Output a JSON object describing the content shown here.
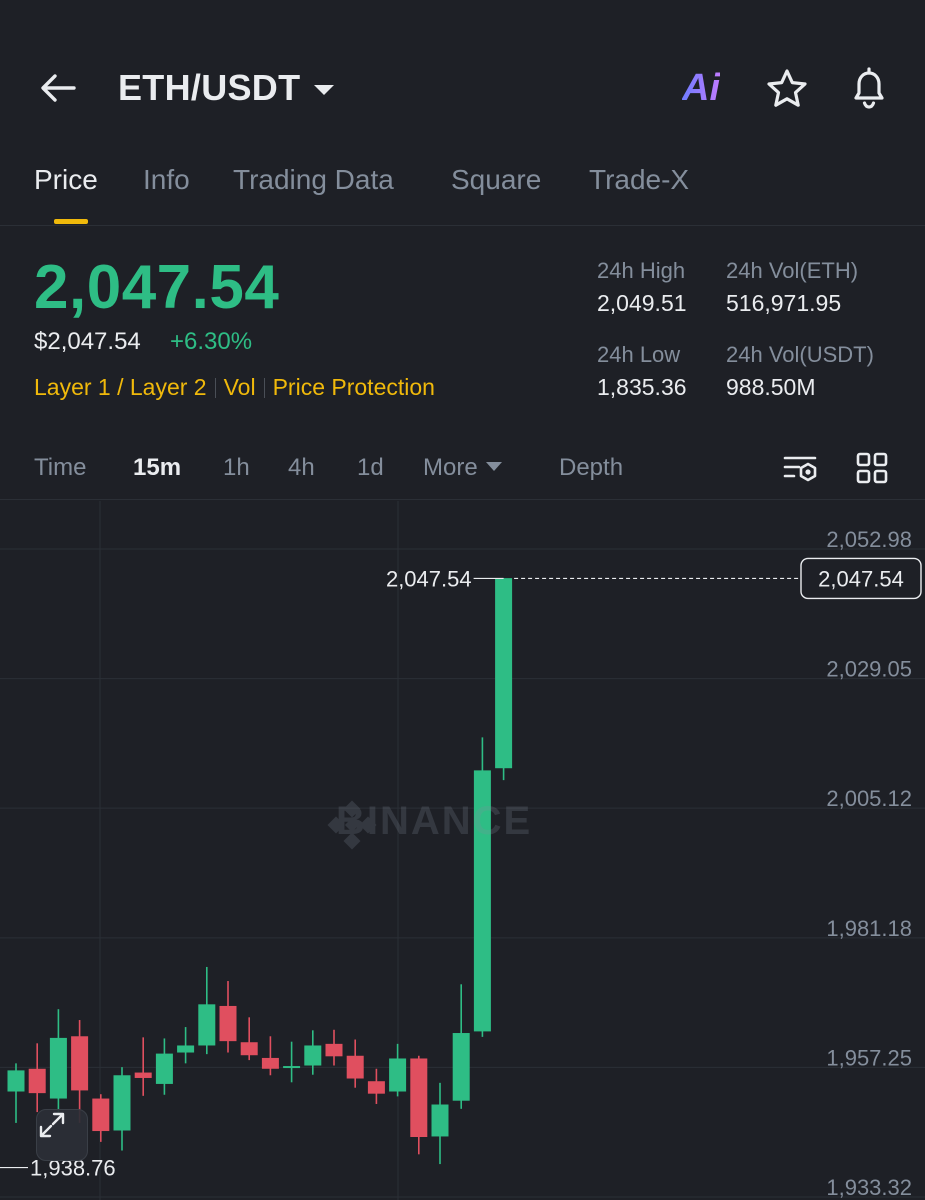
{
  "header": {
    "pair": "ETH/USDT",
    "ai_label": "Ai"
  },
  "tabs": [
    "Price",
    "Info",
    "Trading Data",
    "Square",
    "Trade-X"
  ],
  "ticker": {
    "last_price": "2,047.54",
    "usd_price": "$2,047.54",
    "change": "+6.30%",
    "tags": [
      "Layer 1 / Layer 2",
      "Vol",
      "Price Protection"
    ],
    "stats": {
      "high_label": "24h High",
      "high_value": "2,049.51",
      "vol_eth_label": "24h Vol(ETH)",
      "vol_eth_value": "516,971.95",
      "low_label": "24h Low",
      "low_value": "1,835.36",
      "vol_usdt_label": "24h Vol(USDT)",
      "vol_usdt_value": "988.50M"
    }
  },
  "intervals": {
    "items": [
      "Time",
      "15m",
      "1h",
      "4h",
      "1d"
    ],
    "active": "15m",
    "more_label": "More",
    "depth_label": "Depth"
  },
  "chart_data": {
    "type": "candlestick",
    "watermark": "BINANCE",
    "y_ticks": [
      2052.98,
      2029.05,
      2005.12,
      1981.18,
      1957.25,
      1933.32
    ],
    "y_tick_labels": [
      "2,052.98",
      "2,029.05",
      "2,005.12",
      "1,981.18",
      "1,957.25",
      "1,933.32"
    ],
    "last_price": 2047.54,
    "last_price_label": "2,047.54",
    "high_marker_label": "2,047.54",
    "low_marker": 1938.76,
    "low_marker_label": "1,938.76",
    "colors": {
      "up": "#2ebd85",
      "down": "#e04f5f",
      "grid": "#2b2f36",
      "axis_text": "#848e9c"
    },
    "candles": [
      {
        "o": 1952.8,
        "c": 1956.7,
        "h": 1958.0,
        "l": 1947.0
      },
      {
        "o": 1957.0,
        "c": 1952.5,
        "h": 1961.7,
        "l": 1949.0
      },
      {
        "o": 1951.5,
        "c": 1962.7,
        "h": 1968.0,
        "l": 1948.4
      },
      {
        "o": 1963.0,
        "c": 1953.0,
        "h": 1966.0,
        "l": 1947.0
      },
      {
        "o": 1951.5,
        "c": 1945.5,
        "h": 1952.3,
        "l": 1943.5
      },
      {
        "o": 1945.6,
        "c": 1955.8,
        "h": 1957.3,
        "l": 1941.9
      },
      {
        "o": 1956.3,
        "c": 1955.3,
        "h": 1962.8,
        "l": 1952.0
      },
      {
        "o": 1954.2,
        "c": 1959.8,
        "h": 1962.6,
        "l": 1952.2
      },
      {
        "o": 1960.0,
        "c": 1961.3,
        "h": 1964.7,
        "l": 1958.0
      },
      {
        "o": 1961.3,
        "c": 1968.9,
        "h": 1975.8,
        "l": 1959.7
      },
      {
        "o": 1968.6,
        "c": 1962.1,
        "h": 1973.2,
        "l": 1960.0
      },
      {
        "o": 1961.9,
        "c": 1959.5,
        "h": 1966.5,
        "l": 1958.6
      },
      {
        "o": 1959.0,
        "c": 1957.0,
        "h": 1963.0,
        "l": 1955.8
      },
      {
        "o": 1957.3,
        "c": 1957.5,
        "h": 1962.0,
        "l": 1954.5
      },
      {
        "o": 1957.6,
        "c": 1961.3,
        "h": 1964.1,
        "l": 1955.9
      },
      {
        "o": 1961.6,
        "c": 1959.3,
        "h": 1964.2,
        "l": 1957.6
      },
      {
        "o": 1959.4,
        "c": 1955.2,
        "h": 1962.4,
        "l": 1953.5
      },
      {
        "o": 1954.7,
        "c": 1952.4,
        "h": 1957.0,
        "l": 1950.5
      },
      {
        "o": 1952.8,
        "c": 1958.9,
        "h": 1961.6,
        "l": 1951.9
      },
      {
        "o": 1958.9,
        "c": 1944.4,
        "h": 1959.4,
        "l": 1941.2
      },
      {
        "o": 1944.5,
        "c": 1950.4,
        "h": 1954.4,
        "l": 1939.4
      },
      {
        "o": 1951.1,
        "c": 1963.6,
        "h": 1972.6,
        "l": 1949.6
      },
      {
        "o": 1963.9,
        "c": 2012.1,
        "h": 2018.2,
        "l": 1962.9
      },
      {
        "o": 2012.5,
        "c": 2047.6,
        "h": 2047.6,
        "l": 2010.3
      }
    ]
  }
}
